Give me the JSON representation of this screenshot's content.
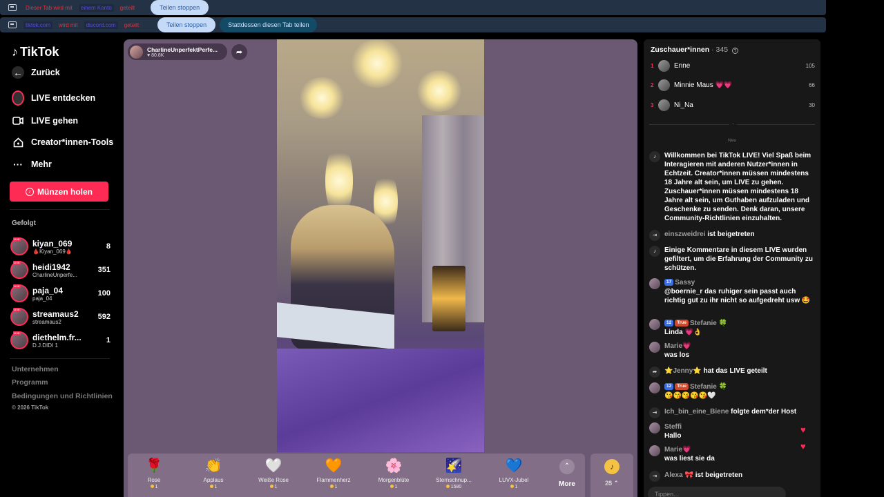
{
  "sharebars": [
    {
      "segments": [
        {
          "text": "Dieser Tab wird mit",
          "tone": "red"
        },
        {
          "text": "einem Konto",
          "tone": "blue"
        },
        {
          "text": "geteilt",
          "tone": "red"
        }
      ],
      "stop_label": "Teilen stoppen"
    },
    {
      "segments": [
        {
          "text": "tiktok.com",
          "tone": "blue"
        },
        {
          "text": "wird mit",
          "tone": "red"
        },
        {
          "text": "discord.com",
          "tone": "blue"
        },
        {
          "text": "geteilt",
          "tone": "red"
        }
      ],
      "stop_label": "Teilen stoppen",
      "share_label": "Stattdessen diesen Tab teilen"
    }
  ],
  "nav": {
    "logo": "TikTok",
    "back": "Zurück",
    "items": [
      "LIVE entdecken",
      "LIVE gehen",
      "Creator*innen-Tools",
      "Mehr"
    ],
    "coins_button": "Münzen holen",
    "followed_title": "Gefolgt",
    "followed": [
      {
        "name": "kiyan_069",
        "sub": "🩸Kiyan_069🩸",
        "count": "8"
      },
      {
        "name": "heidi1942",
        "sub": "CharlineUnperfe...",
        "count": "351"
      },
      {
        "name": "paja_04",
        "sub": "paja_04",
        "count": "100"
      },
      {
        "name": "streamaus2",
        "sub": "streamaus2",
        "count": "592"
      },
      {
        "name": "diethelm.fr...",
        "sub": "D.J.DIDI 1",
        "count": "1"
      }
    ],
    "footer": [
      "Unternehmen",
      "Programm",
      "Bedingungen und Richtlinien"
    ],
    "copyright": "© 2026 TikTok"
  },
  "stream": {
    "host_name": "CharlineUnperfektPerfe...",
    "likes": "♥ 80.8K"
  },
  "gifts": [
    {
      "name": "Rose",
      "price": "1",
      "icon": "🌹"
    },
    {
      "name": "Applaus",
      "price": "1",
      "icon": "👏"
    },
    {
      "name": "Weiße Rose",
      "price": "1",
      "icon": "🤍"
    },
    {
      "name": "Flammenherz",
      "price": "1",
      "icon": "🧡"
    },
    {
      "name": "Morgenblüte",
      "price": "1",
      "icon": "🌸"
    },
    {
      "name": "Sternschnup...",
      "price": "1580",
      "icon": "🌠"
    },
    {
      "name": "LUVX-Jubel",
      "price": "1",
      "icon": "💙"
    }
  ],
  "more_label": "More",
  "coin_count": "28",
  "viewers": {
    "title": "Zuschauer*innen",
    "count": "· 345",
    "top": [
      {
        "rank": "1",
        "name": "Enne",
        "score": "105"
      },
      {
        "rank": "2",
        "name": "Minnie Maus 💗💗",
        "score": "66"
      },
      {
        "rank": "3",
        "name": "Ni_Na",
        "score": "30"
      }
    ],
    "new_label": "Neu"
  },
  "chat": {
    "welcome": "Willkommen bei TikTok LIVE! Viel Spaß beim Interagieren mit anderen Nutzer*innen in Echtzeit. Creator*innen müssen mindestens 18 Jahre alt sein, um LIVE zu gehen. Zuschauer*innen müssen mindestens 18 Jahre alt sein, um Guthaben aufzuladen und Geschenke zu senden. Denk daran, unsere Community-Richtlinien einzuhalten.",
    "join1_user": "einszweidrei",
    "join1_text": "ist beigetreten",
    "filter_text": "Einige Kommentare in diesem LIVE wurden gefiltert, um die Erfahrung der Community zu schützen.",
    "sassy_level": "17",
    "sassy_user": "Sassy",
    "sassy_text": "@boernie_r das ruhiger sein passt auch richtig gut zu ihr nicht so aufgedreht usw 🤩",
    "stef1_level": "12",
    "stef1_tag": "True",
    "stef1_user": "Stefanie 🍀",
    "stef1_text": "Linda 💗👌",
    "marie1_user": "Marie💗",
    "marie1_text": "was los",
    "jenny_user": "⭐Jenny⭐",
    "jenny_text": "hat das LIVE geteilt",
    "stef2_level": "12",
    "stef2_tag": "True",
    "stef2_user": "Stefanie 🍀",
    "stef2_text": "😘😘😘😘😘🤍",
    "biene_user": "Ich_bin_eine_Biene",
    "biene_text": "folgte dem*der Host",
    "steffi_user": "Steffi",
    "steffi_text": "Hallo",
    "marie2_user": "Marie💗",
    "marie2_text": "was liest sie da",
    "alexa_user": "Alexa 🎀",
    "alexa_text": "ist beigetreten",
    "input_placeholder": "Tippen..."
  }
}
